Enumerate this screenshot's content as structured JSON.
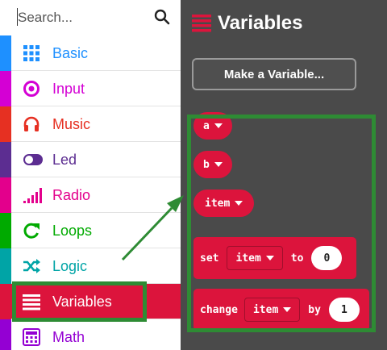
{
  "search": {
    "placeholder": "Search..."
  },
  "categories": [
    {
      "label": "Basic",
      "icon": "grid-icon",
      "color": "#1e90ff"
    },
    {
      "label": "Input",
      "icon": "target-icon",
      "color": "#d400d4"
    },
    {
      "label": "Music",
      "icon": "headphones-icon",
      "color": "#e63022"
    },
    {
      "label": "Led",
      "icon": "toggle-icon",
      "color": "#5c2d91"
    },
    {
      "label": "Radio",
      "icon": "signal-bars-icon",
      "color": "#e3008c"
    },
    {
      "label": "Loops",
      "icon": "loop-arrow-icon",
      "color": "#00aa00"
    },
    {
      "label": "Logic",
      "icon": "shuffle-icon",
      "color": "#00a4a6"
    },
    {
      "label": "Variables",
      "icon": "list-icon",
      "color": "#dc143c",
      "selected": true
    },
    {
      "label": "Math",
      "icon": "calculator-icon",
      "color": "#9400d3"
    }
  ],
  "flyout": {
    "title": "Variables",
    "make_variable_label": "Make a Variable...",
    "blocks": {
      "var_a": "a",
      "var_b": "b",
      "var_item": "item",
      "set": {
        "keyword": "set",
        "variable": "item",
        "to": "to",
        "value": "0"
      },
      "change": {
        "keyword": "change",
        "variable": "item",
        "by": "by",
        "value": "1"
      }
    }
  },
  "colors": {
    "variables": "#dc143c",
    "flyout_bg": "#4a4a4a",
    "highlight": "#2e8b34"
  }
}
